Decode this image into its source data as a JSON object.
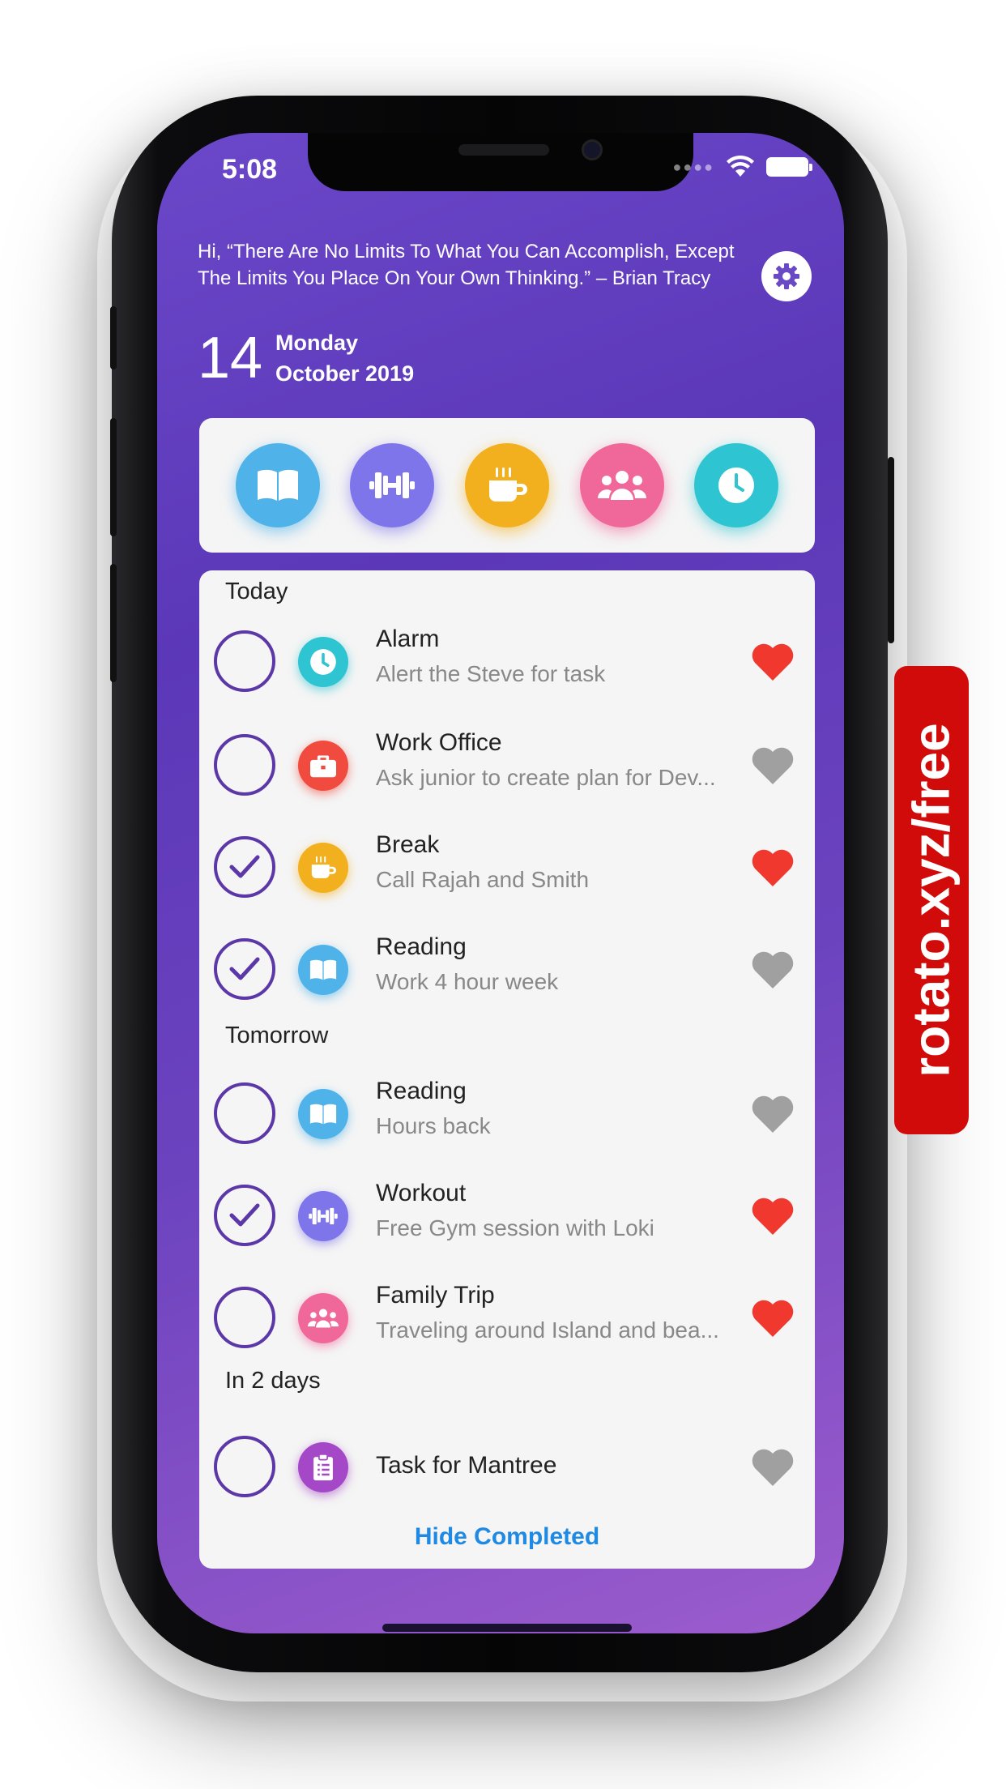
{
  "status_bar": {
    "time": "5:08"
  },
  "header": {
    "quote": "Hi, “There Are No Limits To What You Can Accomplish, Except The Limits You Place On Your Own Thinking.” – Brian Tracy",
    "day": "14",
    "weekday": "Monday",
    "month_year": "October 2019"
  },
  "categories": [
    {
      "icon": "book-icon",
      "color": "#4fb3ea"
    },
    {
      "icon": "dumbbell-icon",
      "color": "#7f75ea"
    },
    {
      "icon": "coffee-icon",
      "color": "#f2b01e"
    },
    {
      "icon": "people-icon",
      "color": "#f0679a"
    },
    {
      "icon": "clock-icon",
      "color": "#2ec4d2"
    }
  ],
  "sections": [
    {
      "title": "Today"
    },
    {
      "title": "Tomorrow"
    },
    {
      "title": "In 2 days"
    }
  ],
  "tasks": [
    {
      "title": "Alarm",
      "subtitle": "Alert the Steve for task",
      "icon": "clock-icon",
      "color": "#2ec4d2",
      "completed": false,
      "favorite": true
    },
    {
      "title": "Work Office",
      "subtitle": "Ask junior to create plan for Dev...",
      "icon": "briefcase-icon",
      "color": "#f04b3e",
      "completed": false,
      "favorite": false
    },
    {
      "title": "Break",
      "subtitle": "Call Rajah and Smith",
      "icon": "coffee-icon",
      "color": "#f2b01e",
      "completed": true,
      "favorite": true
    },
    {
      "title": "Reading",
      "subtitle": "Work 4 hour week",
      "icon": "book-icon",
      "color": "#4fb3ea",
      "completed": true,
      "favorite": false
    },
    {
      "title": "Reading",
      "subtitle": "Hours back",
      "icon": "book-icon",
      "color": "#4fb3ea",
      "completed": false,
      "favorite": false
    },
    {
      "title": "Workout",
      "subtitle": "Free Gym session with Loki",
      "icon": "dumbbell-icon",
      "color": "#7f75ea",
      "completed": true,
      "favorite": true
    },
    {
      "title": "Family Trip",
      "subtitle": "Traveling around Island and bea...",
      "icon": "people-icon",
      "color": "#f0679a",
      "completed": false,
      "favorite": true
    },
    {
      "title": "Task for Mantree",
      "subtitle": "",
      "icon": "clipboard-icon",
      "color": "#a548c7",
      "completed": false,
      "favorite": false
    }
  ],
  "footer": {
    "hide_completed": "Hide Completed"
  },
  "watermark": {
    "text": "rotato.xyz/free"
  },
  "colors": {
    "accent": "#5b37a8",
    "favorite": "#f0382f",
    "not_favorite": "#a0a0a0",
    "link": "#1f8ae3"
  }
}
